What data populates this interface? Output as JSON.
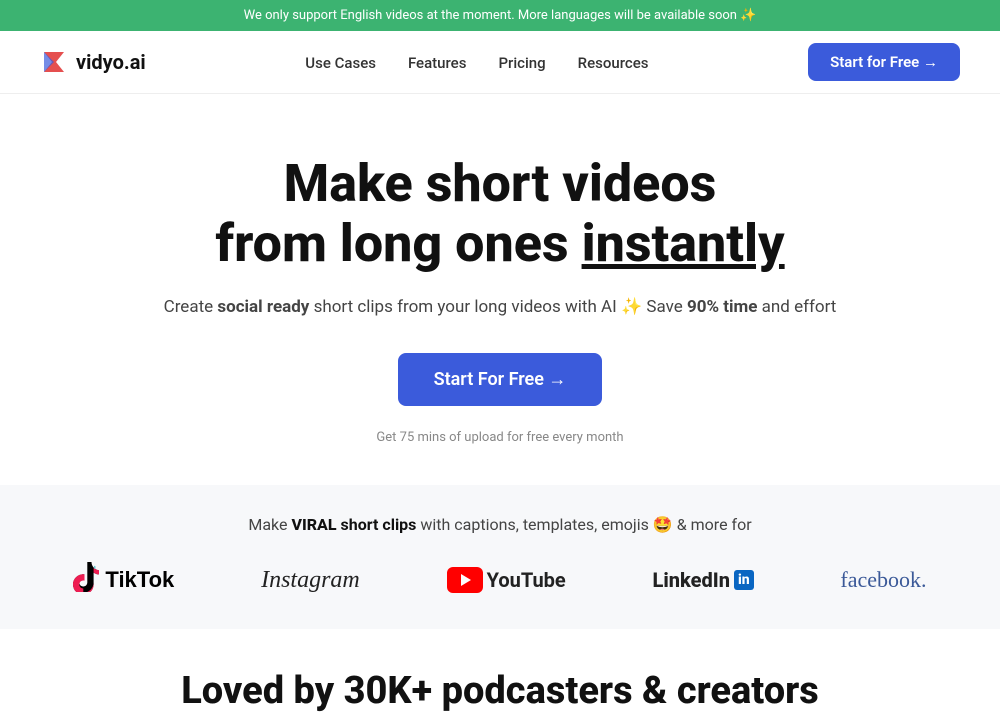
{
  "banner": {
    "text": "We only support English videos at the moment. More languages will be available soon",
    "sparkle": "✨"
  },
  "nav": {
    "logo_text": "vidyo.ai",
    "links": [
      {
        "label": "Use Cases",
        "href": "#"
      },
      {
        "label": "Features",
        "href": "#"
      },
      {
        "label": "Pricing",
        "href": "#"
      },
      {
        "label": "Resources",
        "href": "#"
      }
    ],
    "cta_label": "Start for Free →"
  },
  "hero": {
    "headline_line1": "Make short videos",
    "headline_line2": "from long ones",
    "headline_word_underline": "instantly",
    "description_part1": "Create",
    "description_bold1": "social ready",
    "description_part2": "short clips from your long videos with AI ✨ Save",
    "description_bold2": "90% time",
    "description_part3": "and effort",
    "cta_label": "Start For Free →",
    "subtext": "Get 75 mins of upload for free every month"
  },
  "platforms": {
    "tagline_part1": "Make",
    "viral": "VIRAL",
    "clips": "short clips",
    "tagline_part2": "with captions, templates, emojis 🤩 & more for",
    "logos": [
      {
        "name": "TikTok",
        "type": "tiktok"
      },
      {
        "name": "Instagram",
        "type": "instagram"
      },
      {
        "name": "YouTube",
        "type": "youtube"
      },
      {
        "name": "LinkedIn",
        "type": "linkedin"
      },
      {
        "name": "facebook.",
        "type": "facebook"
      }
    ]
  },
  "loved": {
    "headline": "Loved by 30K+ podcasters & creators"
  }
}
